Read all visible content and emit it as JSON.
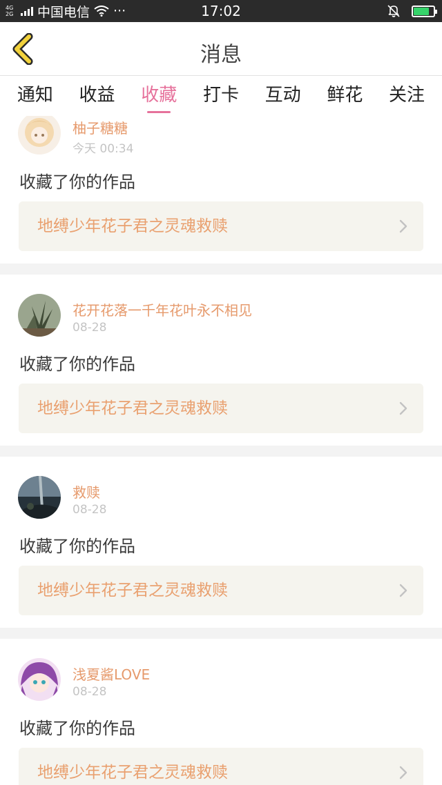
{
  "status_bar": {
    "network_top": "4G",
    "network_bottom": "2G",
    "carrier": "中国电信",
    "more": "···",
    "time": "17:02",
    "battery_level": 0.8
  },
  "header": {
    "title": "消息",
    "back_icon": "chevron-left-icon"
  },
  "tabs": [
    {
      "label": "通知"
    },
    {
      "label": "收益"
    },
    {
      "label": "收藏",
      "active": true
    },
    {
      "label": "打卡"
    },
    {
      "label": "互动"
    },
    {
      "label": "鲜花"
    },
    {
      "label": "关注"
    }
  ],
  "messages": [
    {
      "username": "柚子糖糖",
      "time": "今天 00:34",
      "action": "收藏了你的作品",
      "work_title": "地缚少年花子君之灵魂救赎"
    },
    {
      "username": "花开花落一千年花叶永不相见",
      "time": "08-28",
      "action": "收藏了你的作品",
      "work_title": "地缚少年花子君之灵魂救赎"
    },
    {
      "username": "救赎",
      "time": "08-28",
      "action": "收藏了你的作品",
      "work_title": "地缚少年花子君之灵魂救赎"
    },
    {
      "username": "浅夏酱LOVE",
      "time": "08-28",
      "action": "收藏了你的作品",
      "work_title": "地缚少年花子君之灵魂救赎"
    }
  ],
  "colors": {
    "accent": "#e6719b",
    "username": "#e69a6c",
    "work_title": "#e9a06f",
    "back_arrow": "#f2d23c"
  }
}
